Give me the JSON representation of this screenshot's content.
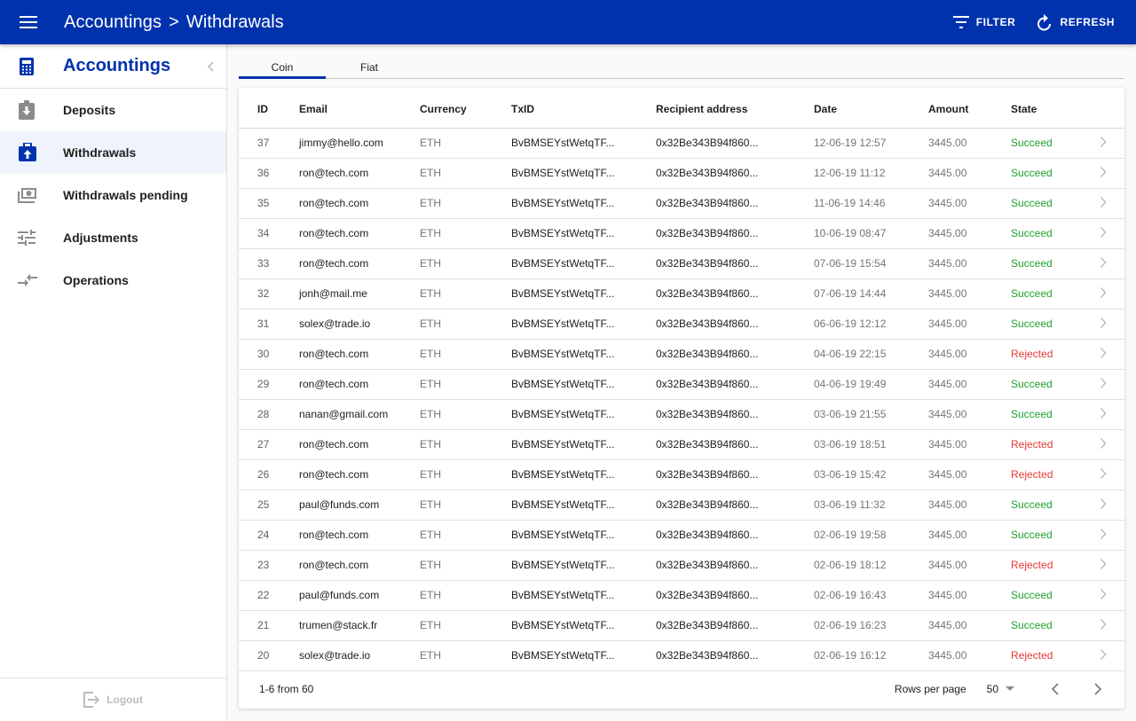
{
  "appbar": {
    "menu_icon": "hamburger-menu-icon",
    "breadcrumb": [
      "Accountings",
      "Withdrawals"
    ],
    "breadcrumb_separator": ">",
    "actions": [
      {
        "label": "FILTER",
        "icon": "filter-icon"
      },
      {
        "label": "REFRESH",
        "icon": "refresh-icon"
      }
    ],
    "brand_color": "#0032ad"
  },
  "sidebar": {
    "title": "Accountings",
    "title_icon": "calculator-icon",
    "collapse_icon": "chevron-left-icon",
    "items": [
      {
        "label": "Deposits",
        "icon": "deposit-icon",
        "active": false
      },
      {
        "label": "Withdrawals",
        "icon": "withdrawal-icon",
        "active": true
      },
      {
        "label": "Withdrawals pending",
        "icon": "money-pending-icon",
        "active": false
      },
      {
        "label": "Adjustments",
        "icon": "sliders-icon",
        "active": false
      },
      {
        "label": "Operations",
        "icon": "compare-arrows-icon",
        "active": false
      }
    ],
    "logout_label": "Logout",
    "logout_icon": "logout-icon"
  },
  "tabs": [
    {
      "label": "Coin",
      "active": true
    },
    {
      "label": "Fiat",
      "active": false
    }
  ],
  "table": {
    "columns": [
      "ID",
      "Email",
      "Currency",
      "TxID",
      "Recipient address",
      "Date",
      "Amount",
      "State"
    ],
    "rows": [
      {
        "id": "37",
        "email": "jimmy@hello.com",
        "currency": "ETH",
        "txid": "BvBMSEYstWetqTF...",
        "recipient": "0x32Be343B94f860...",
        "date": "12-06-19 12:57",
        "amount": "3445.00",
        "state": "Succeed"
      },
      {
        "id": "36",
        "email": "ron@tech.com",
        "currency": "ETH",
        "txid": "BvBMSEYstWetqTF...",
        "recipient": "0x32Be343B94f860...",
        "date": "12-06-19 11:12",
        "amount": "3445.00",
        "state": "Succeed"
      },
      {
        "id": "35",
        "email": "ron@tech.com",
        "currency": "ETH",
        "txid": "BvBMSEYstWetqTF...",
        "recipient": "0x32Be343B94f860...",
        "date": "11-06-19 14:46",
        "amount": "3445.00",
        "state": "Succeed"
      },
      {
        "id": "34",
        "email": "ron@tech.com",
        "currency": "ETH",
        "txid": "BvBMSEYstWetqTF...",
        "recipient": "0x32Be343B94f860...",
        "date": "10-06-19 08:47",
        "amount": "3445.00",
        "state": "Succeed"
      },
      {
        "id": "33",
        "email": "ron@tech.com",
        "currency": "ETH",
        "txid": "BvBMSEYstWetqTF...",
        "recipient": "0x32Be343B94f860...",
        "date": "07-06-19 15:54",
        "amount": "3445.00",
        "state": "Succeed"
      },
      {
        "id": "32",
        "email": "jonh@mail.me",
        "currency": "ETH",
        "txid": "BvBMSEYstWetqTF...",
        "recipient": "0x32Be343B94f860...",
        "date": "07-06-19 14:44",
        "amount": "3445.00",
        "state": "Succeed"
      },
      {
        "id": "31",
        "email": "solex@trade.io",
        "currency": "ETH",
        "txid": "BvBMSEYstWetqTF...",
        "recipient": "0x32Be343B94f860...",
        "date": "06-06-19 12:12",
        "amount": "3445.00",
        "state": "Succeed"
      },
      {
        "id": "30",
        "email": "ron@tech.com",
        "currency": "ETH",
        "txid": "BvBMSEYstWetqTF...",
        "recipient": "0x32Be343B94f860...",
        "date": "04-06-19 22:15",
        "amount": "3445.00",
        "state": "Rejected"
      },
      {
        "id": "29",
        "email": "ron@tech.com",
        "currency": "ETH",
        "txid": "BvBMSEYstWetqTF...",
        "recipient": "0x32Be343B94f860...",
        "date": "04-06-19 19:49",
        "amount": "3445.00",
        "state": "Succeed"
      },
      {
        "id": "28",
        "email": "nanan@gmail.com",
        "currency": "ETH",
        "txid": "BvBMSEYstWetqTF...",
        "recipient": "0x32Be343B94f860...",
        "date": "03-06-19 21:55",
        "amount": "3445.00",
        "state": "Succeed"
      },
      {
        "id": "27",
        "email": "ron@tech.com",
        "currency": "ETH",
        "txid": "BvBMSEYstWetqTF...",
        "recipient": "0x32Be343B94f860...",
        "date": "03-06-19 18:51",
        "amount": "3445.00",
        "state": "Rejected"
      },
      {
        "id": "26",
        "email": "ron@tech.com",
        "currency": "ETH",
        "txid": "BvBMSEYstWetqTF...",
        "recipient": "0x32Be343B94f860...",
        "date": "03-06-19 15:42",
        "amount": "3445.00",
        "state": "Rejected"
      },
      {
        "id": "25",
        "email": "paul@funds.com",
        "currency": "ETH",
        "txid": "BvBMSEYstWetqTF...",
        "recipient": "0x32Be343B94f860...",
        "date": "03-06-19 11:32",
        "amount": "3445.00",
        "state": "Succeed"
      },
      {
        "id": "24",
        "email": "ron@tech.com",
        "currency": "ETH",
        "txid": "BvBMSEYstWetqTF...",
        "recipient": "0x32Be343B94f860...",
        "date": "02-06-19 19:58",
        "amount": "3445.00",
        "state": "Succeed"
      },
      {
        "id": "23",
        "email": "ron@tech.com",
        "currency": "ETH",
        "txid": "BvBMSEYstWetqTF...",
        "recipient": "0x32Be343B94f860...",
        "date": "02-06-19 18:12",
        "amount": "3445.00",
        "state": "Rejected"
      },
      {
        "id": "22",
        "email": "paul@funds.com",
        "currency": "ETH",
        "txid": "BvBMSEYstWetqTF...",
        "recipient": "0x32Be343B94f860...",
        "date": "02-06-19 16:43",
        "amount": "3445.00",
        "state": "Succeed"
      },
      {
        "id": "21",
        "email": "trumen@stack.fr",
        "currency": "ETH",
        "txid": "BvBMSEYstWetqTF...",
        "recipient": "0x32Be343B94f860...",
        "date": "02-06-19 16:23",
        "amount": "3445.00",
        "state": "Succeed"
      },
      {
        "id": "20",
        "email": "solex@trade.io",
        "currency": "ETH",
        "txid": "BvBMSEYstWetqTF...",
        "recipient": "0x32Be343B94f860...",
        "date": "02-06-19 16:12",
        "amount": "3445.00",
        "state": "Rejected"
      }
    ],
    "row_action_icon": "chevron-right-icon"
  },
  "pagination": {
    "summary": "1-6 from 60",
    "rows_per_page_label": "Rows per page",
    "rows_per_page_value": "50",
    "prev_icon": "chevron-left-icon",
    "next_icon": "chevron-right-icon"
  },
  "colors": {
    "succeed": "#1fa12f",
    "rejected": "#e53935",
    "active_item_bg": "#eff3fb"
  }
}
